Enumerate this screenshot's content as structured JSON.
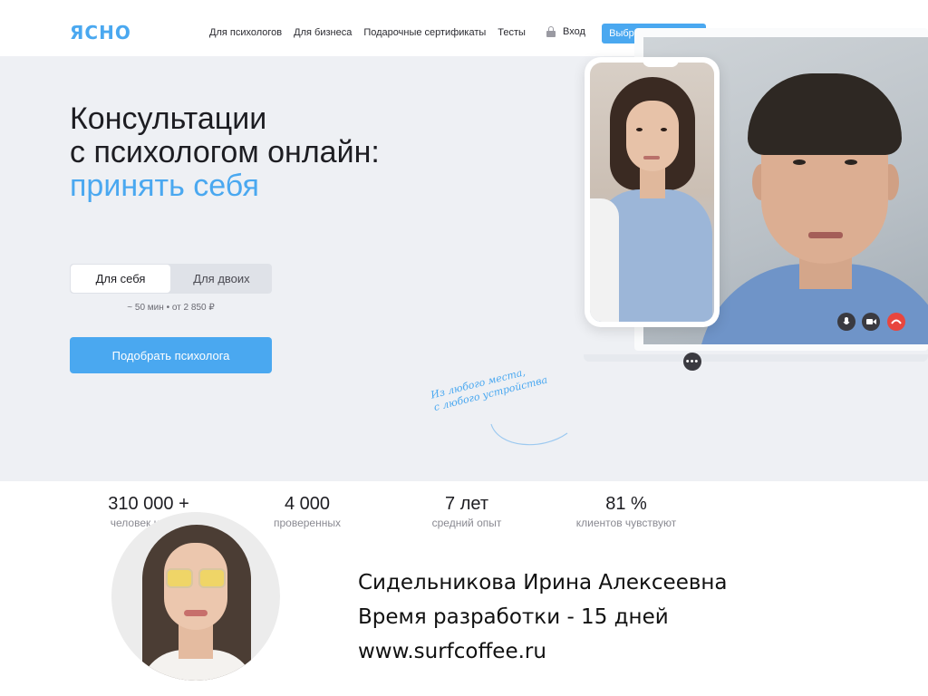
{
  "header": {
    "logo": "ЯСНО",
    "nav": [
      "Для психологов",
      "Для бизнеса",
      "Подарочные сертификаты",
      "Тесты"
    ],
    "login_label": "Вход",
    "login_icon": "lock-icon",
    "cta_label": "Выбрать психолога"
  },
  "hero": {
    "title_line1": "Консультации",
    "title_line2": "с психологом онлайн:",
    "title_accent": "принять себя",
    "toggle": {
      "active": "Для себя",
      "inactive": "Для двоих"
    },
    "meta": "~ 50 мин • от 2 850 ₽",
    "cta_label": "Подобрать психолога",
    "handwriting_line1": "Из любого места,",
    "handwriting_line2": "с любого устройства",
    "call_controls": [
      "mic-icon",
      "camera-icon",
      "hangup-icon"
    ],
    "more_icon": "more-dots-icon"
  },
  "stats": [
    {
      "value": "310 000 +",
      "label": "человек нашли"
    },
    {
      "value": "4 000",
      "label": "проверенных"
    },
    {
      "value": "7 лет",
      "label": "средний опыт"
    },
    {
      "value": "81 %",
      "label": "клиентов чувствуют"
    }
  ],
  "credits": {
    "author": "Сидельникова Ирина Алексеевна",
    "time": "Время разработки - 15 дней",
    "site": "www.surfcoffee.ru"
  },
  "colors": {
    "accent": "#4aa8f0",
    "hero_bg": "#eef0f4",
    "hangup": "#e8463e"
  }
}
